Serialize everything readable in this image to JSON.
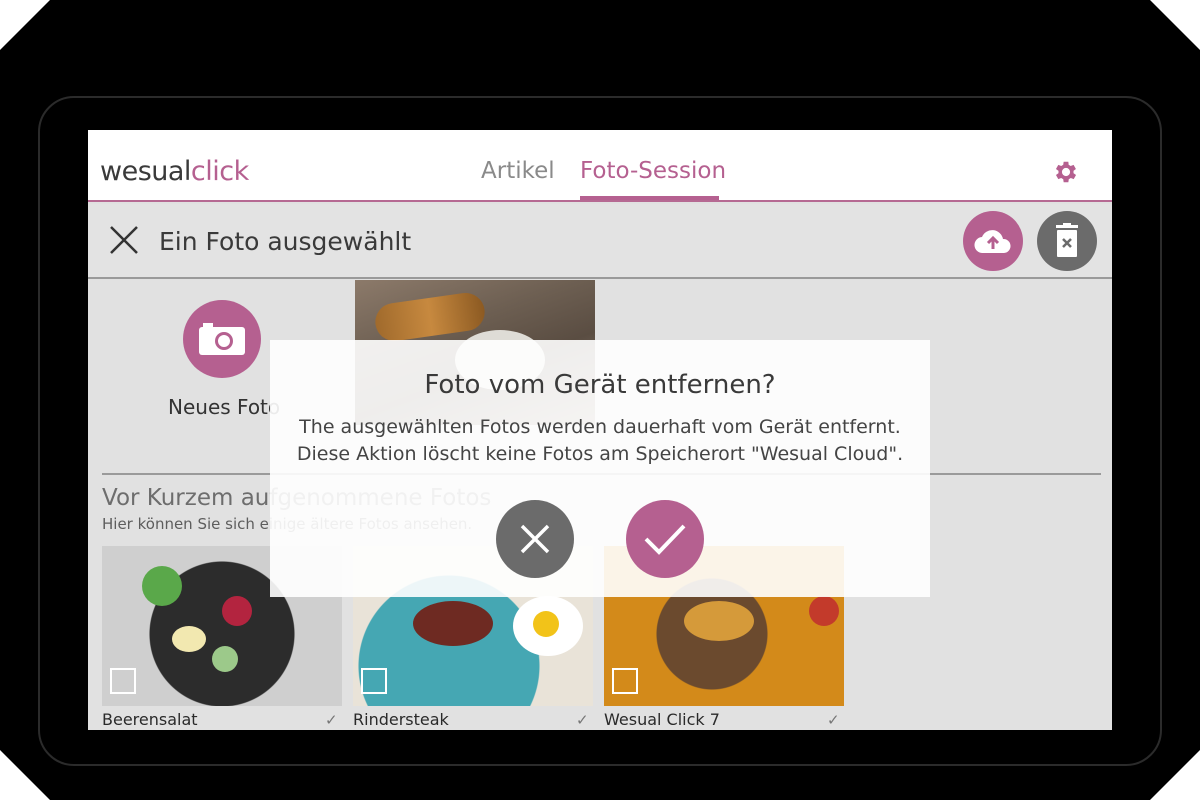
{
  "header": {
    "logo_part1": "wesual",
    "logo_part2": "click",
    "tabs": [
      {
        "label": "Artikel",
        "active": false
      },
      {
        "label": "Foto-Session",
        "active": true
      }
    ],
    "settings_icon": "gear-icon"
  },
  "selection_bar": {
    "title": "Ein Foto ausgewählt",
    "close_icon": "close-icon",
    "upload_icon": "cloud-upload-icon",
    "delete_icon": "trash-icon"
  },
  "new_photo": {
    "label": "Neues Foto",
    "icon": "camera-icon"
  },
  "recent": {
    "title": "Vor Kurzem aufgenommene Fotos",
    "subtitle": "Hier können Sie sich einige ältere Fotos ansehen.",
    "items": [
      {
        "label": "Beerensalat",
        "selected": false
      },
      {
        "label": "Rindersteak",
        "selected": false
      },
      {
        "label": "Wesual Click 7",
        "selected": false
      }
    ]
  },
  "dialog": {
    "title": "Foto vom Gerät entfernen?",
    "message_line1": "The ausgewählten Fotos werden dauerhaft vom Gerät entfernt.",
    "message_line2": "Diese Aktion löscht keine Fotos am Speicherort \"Wesual Cloud\".",
    "cancel_icon": "close-icon",
    "confirm_icon": "checkmark-icon"
  },
  "colors": {
    "accent": "#b56090",
    "grey_button": "#6b6b6b",
    "background": "#e1e1e1"
  }
}
